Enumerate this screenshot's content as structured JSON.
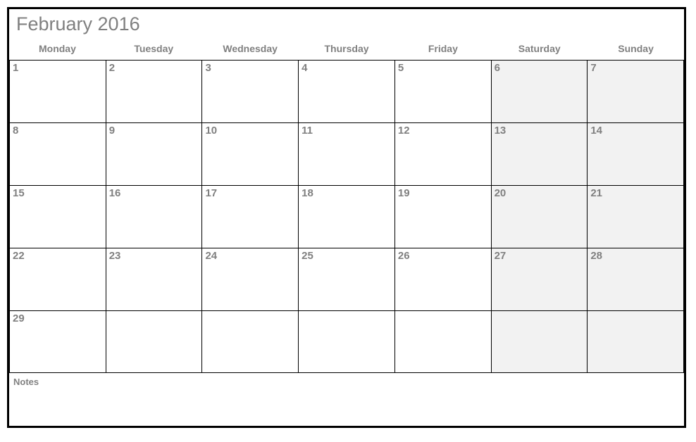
{
  "title": "February 2016",
  "day_headers": [
    "Monday",
    "Tuesday",
    "Wednesday",
    "Thursday",
    "Friday",
    "Saturday",
    "Sunday"
  ],
  "weeks": [
    [
      {
        "num": "1",
        "weekend": false,
        "empty": false
      },
      {
        "num": "2",
        "weekend": false,
        "empty": false
      },
      {
        "num": "3",
        "weekend": false,
        "empty": false
      },
      {
        "num": "4",
        "weekend": false,
        "empty": false
      },
      {
        "num": "5",
        "weekend": false,
        "empty": false
      },
      {
        "num": "6",
        "weekend": true,
        "empty": false
      },
      {
        "num": "7",
        "weekend": true,
        "empty": false
      }
    ],
    [
      {
        "num": "8",
        "weekend": false,
        "empty": false
      },
      {
        "num": "9",
        "weekend": false,
        "empty": false
      },
      {
        "num": "10",
        "weekend": false,
        "empty": false
      },
      {
        "num": "11",
        "weekend": false,
        "empty": false
      },
      {
        "num": "12",
        "weekend": false,
        "empty": false
      },
      {
        "num": "13",
        "weekend": true,
        "empty": false
      },
      {
        "num": "14",
        "weekend": true,
        "empty": false
      }
    ],
    [
      {
        "num": "15",
        "weekend": false,
        "empty": false
      },
      {
        "num": "16",
        "weekend": false,
        "empty": false
      },
      {
        "num": "17",
        "weekend": false,
        "empty": false
      },
      {
        "num": "18",
        "weekend": false,
        "empty": false
      },
      {
        "num": "19",
        "weekend": false,
        "empty": false
      },
      {
        "num": "20",
        "weekend": true,
        "empty": false
      },
      {
        "num": "21",
        "weekend": true,
        "empty": false
      }
    ],
    [
      {
        "num": "22",
        "weekend": false,
        "empty": false
      },
      {
        "num": "23",
        "weekend": false,
        "empty": false
      },
      {
        "num": "24",
        "weekend": false,
        "empty": false
      },
      {
        "num": "25",
        "weekend": false,
        "empty": false
      },
      {
        "num": "26",
        "weekend": false,
        "empty": false
      },
      {
        "num": "27",
        "weekend": true,
        "empty": false
      },
      {
        "num": "28",
        "weekend": true,
        "empty": false
      }
    ],
    [
      {
        "num": "29",
        "weekend": false,
        "empty": false
      },
      {
        "num": "",
        "weekend": false,
        "empty": true
      },
      {
        "num": "",
        "weekend": false,
        "empty": true
      },
      {
        "num": "",
        "weekend": false,
        "empty": true
      },
      {
        "num": "",
        "weekend": false,
        "empty": true
      },
      {
        "num": "",
        "weekend": true,
        "empty": true
      },
      {
        "num": "",
        "weekend": true,
        "empty": true
      }
    ]
  ],
  "notes_label": "Notes"
}
